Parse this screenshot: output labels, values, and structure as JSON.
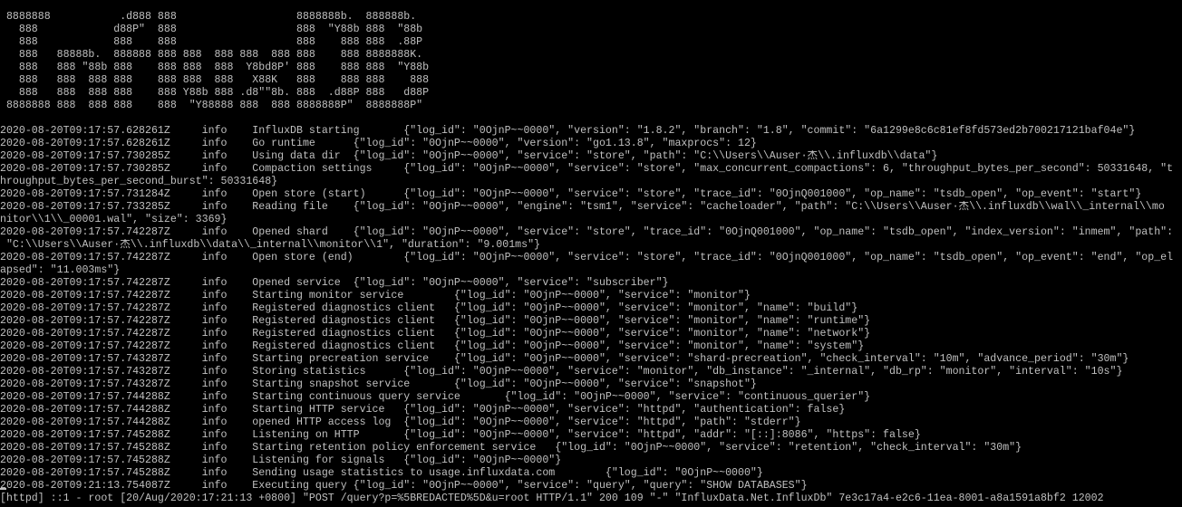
{
  "colors": {
    "background": "#000000",
    "text": "#c0c0c0"
  },
  "banner": [
    " 8888888           .d888 888                   8888888b.  888888b.",
    "   888            d88P\"  888                   888  \"Y88b 888  \"88b",
    "   888            888    888                   888    888 888  .88P",
    "   888   88888b.  888888 888 888  888 888  888 888    888 8888888K.",
    "   888   888 \"88b 888    888 888  888  Y8bd8P' 888    888 888  \"Y88b",
    "   888   888  888 888    888 888  888   X88K   888    888 888    888",
    "   888   888  888 888    888 Y88b 888 .d8\"\"8b. 888  .d88P 888   d88P",
    " 8888888 888  888 888    888  \"Y88888 888  888 8888888P\"  8888888P\""
  ],
  "log_lines": [
    "2020-08-20T09:17:57.628261Z     info    InfluxDB starting       {\"log_id\": \"0OjnP~~0000\", \"version\": \"1.8.2\", \"branch\": \"1.8\", \"commit\": \"6a1299e8c6c81ef8fd573ed2b700217121baf04e\"}",
    "2020-08-20T09:17:57.628261Z     info    Go runtime      {\"log_id\": \"0OjnP~~0000\", \"version\": \"go1.13.8\", \"maxprocs\": 12}",
    "2020-08-20T09:17:57.730285Z     info    Using data dir  {\"log_id\": \"0OjnP~~0000\", \"service\": \"store\", \"path\": \"C:\\\\Users\\\\Auser·杰\\\\.influxdb\\\\data\"}",
    "2020-08-20T09:17:57.730285Z     info    Compaction settings     {\"log_id\": \"0OjnP~~0000\", \"service\": \"store\", \"max_concurrent_compactions\": 6, \"throughput_bytes_per_second\": 50331648, \"t",
    "hroughput_bytes_per_second_burst\": 50331648}",
    "2020-08-20T09:17:57.731284Z     info    Open store (start)      {\"log_id\": \"0OjnP~~0000\", \"service\": \"store\", \"trace_id\": \"0OjnQ001000\", \"op_name\": \"tsdb_open\", \"op_event\": \"start\"}",
    "2020-08-20T09:17:57.733285Z     info    Reading file    {\"log_id\": \"0OjnP~~0000\", \"engine\": \"tsm1\", \"service\": \"cacheloader\", \"path\": \"C:\\\\Users\\\\Auser·杰\\\\.influxdb\\\\wal\\\\_internal\\\\mo",
    "nitor\\\\1\\\\_00001.wal\", \"size\": 3369}",
    "2020-08-20T09:17:57.742287Z     info    Opened shard    {\"log_id\": \"0OjnP~~0000\", \"service\": \"store\", \"trace_id\": \"0OjnQ001000\", \"op_name\": \"tsdb_open\", \"index_version\": \"inmem\", \"path\":",
    " \"C:\\\\Users\\\\Auser·杰\\\\.influxdb\\\\data\\\\_internal\\\\monitor\\\\1\", \"duration\": \"9.001ms\"}",
    "2020-08-20T09:17:57.742287Z     info    Open store (end)        {\"log_id\": \"0OjnP~~0000\", \"service\": \"store\", \"trace_id\": \"0OjnQ001000\", \"op_name\": \"tsdb_open\", \"op_event\": \"end\", \"op_el",
    "apsed\": \"11.003ms\"}",
    "2020-08-20T09:17:57.742287Z     info    Opened service  {\"log_id\": \"0OjnP~~0000\", \"service\": \"subscriber\"}",
    "2020-08-20T09:17:57.742287Z     info    Starting monitor service        {\"log_id\": \"0OjnP~~0000\", \"service\": \"monitor\"}",
    "2020-08-20T09:17:57.742287Z     info    Registered diagnostics client   {\"log_id\": \"0OjnP~~0000\", \"service\": \"monitor\", \"name\": \"build\"}",
    "2020-08-20T09:17:57.742287Z     info    Registered diagnostics client   {\"log_id\": \"0OjnP~~0000\", \"service\": \"monitor\", \"name\": \"runtime\"}",
    "2020-08-20T09:17:57.742287Z     info    Registered diagnostics client   {\"log_id\": \"0OjnP~~0000\", \"service\": \"monitor\", \"name\": \"network\"}",
    "2020-08-20T09:17:57.742287Z     info    Registered diagnostics client   {\"log_id\": \"0OjnP~~0000\", \"service\": \"monitor\", \"name\": \"system\"}",
    "2020-08-20T09:17:57.743287Z     info    Starting precreation service    {\"log_id\": \"0OjnP~~0000\", \"service\": \"shard-precreation\", \"check_interval\": \"10m\", \"advance_period\": \"30m\"}",
    "2020-08-20T09:17:57.743287Z     info    Storing statistics      {\"log_id\": \"0OjnP~~0000\", \"service\": \"monitor\", \"db_instance\": \"_internal\", \"db_rp\": \"monitor\", \"interval\": \"10s\"}",
    "2020-08-20T09:17:57.743287Z     info    Starting snapshot service       {\"log_id\": \"0OjnP~~0000\", \"service\": \"snapshot\"}",
    "2020-08-20T09:17:57.744288Z     info    Starting continuous query service       {\"log_id\": \"0OjnP~~0000\", \"service\": \"continuous_querier\"}",
    "2020-08-20T09:17:57.744288Z     info    Starting HTTP service   {\"log_id\": \"0OjnP~~0000\", \"service\": \"httpd\", \"authentication\": false}",
    "2020-08-20T09:17:57.744288Z     info    opened HTTP access log  {\"log_id\": \"0OjnP~~0000\", \"service\": \"httpd\", \"path\": \"stderr\"}",
    "2020-08-20T09:17:57.745288Z     info    Listening on HTTP       {\"log_id\": \"0OjnP~~0000\", \"service\": \"httpd\", \"addr\": \"[::]:8086\", \"https\": false}",
    "2020-08-20T09:17:57.745288Z     info    Starting retention policy enforcement service   {\"log_id\": \"0OjnP~~0000\", \"service\": \"retention\", \"check_interval\": \"30m\"}",
    "2020-08-20T09:17:57.745288Z     info    Listening for signals   {\"log_id\": \"0OjnP~~0000\"}",
    "2020-08-20T09:17:57.745288Z     info    Sending usage statistics to usage.influxdata.com        {\"log_id\": \"0OjnP~~0000\"}",
    "2020-08-20T09:21:13.754087Z     info    Executing query {\"log_id\": \"0OjnP~~0000\", \"service\": \"query\", \"query\": \"SHOW DATABASES\"}",
    "[httpd] ::1 - root [20/Aug/2020:17:21:13 +0800] \"POST /query?p=%5BREDACTED%5D&u=root HTTP/1.1\" 200 109 \"-\" \"InfluxData.Net.InfluxDb\" 7e3c17a4-e2c6-11ea-8001-a8a1591a8bf2 12002"
  ]
}
